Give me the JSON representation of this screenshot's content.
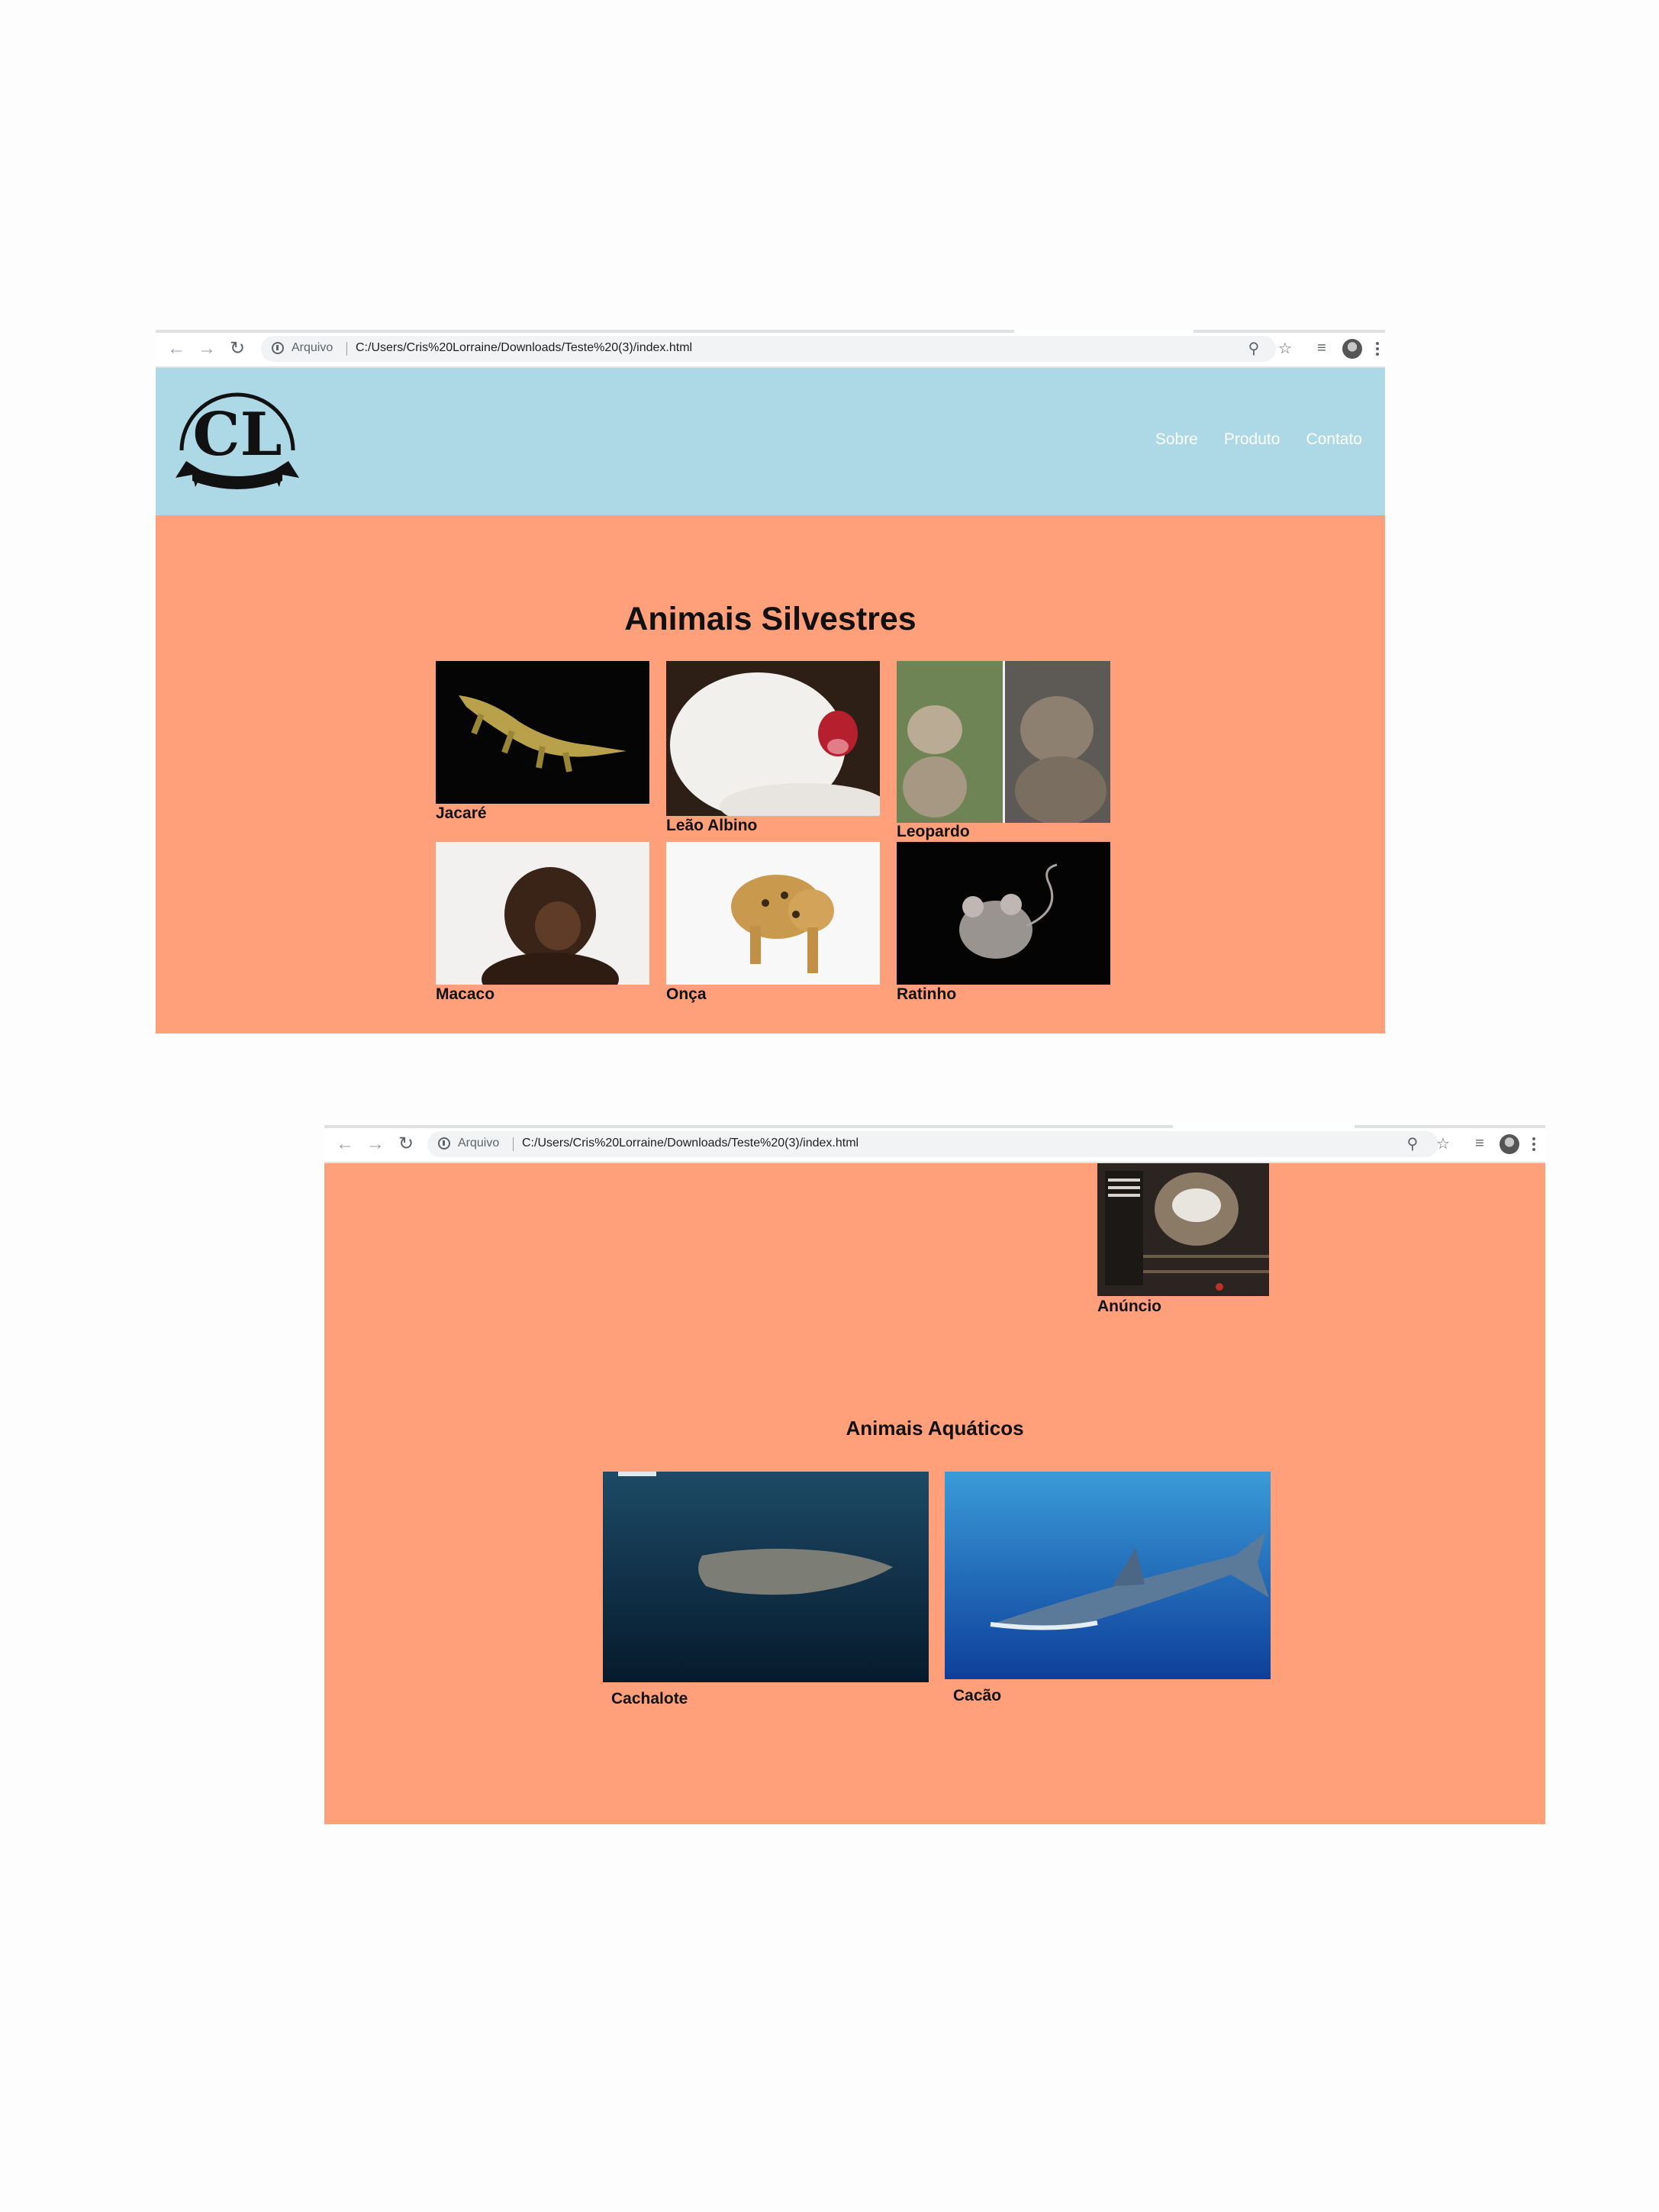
{
  "browser": {
    "scheme": "Arquivo",
    "url": "C:/Users/Cris%20Lorraine/Downloads/Teste%20(3)/index.html"
  },
  "logo": {
    "text": "CL"
  },
  "nav": [
    {
      "label": "Sobre"
    },
    {
      "label": "Produto"
    },
    {
      "label": "Contato"
    }
  ],
  "terrestrial": {
    "title": "Animais Silvestres",
    "items": [
      {
        "label": "Jacaré"
      },
      {
        "label": "Leão Albino"
      },
      {
        "label": "Leopardo"
      },
      {
        "label": "Macaco"
      },
      {
        "label": "Onça"
      },
      {
        "label": "Ratinho"
      }
    ]
  },
  "ad": {
    "label": "Anúncio"
  },
  "aquatic": {
    "title": "Animais Aquáticos",
    "items": [
      {
        "label": "Cachalote"
      },
      {
        "label": "Cacão"
      }
    ]
  },
  "colors": {
    "header_bg": "#add8e6",
    "page_bg": "#ffa07a",
    "nav_text": "#ffffff"
  }
}
